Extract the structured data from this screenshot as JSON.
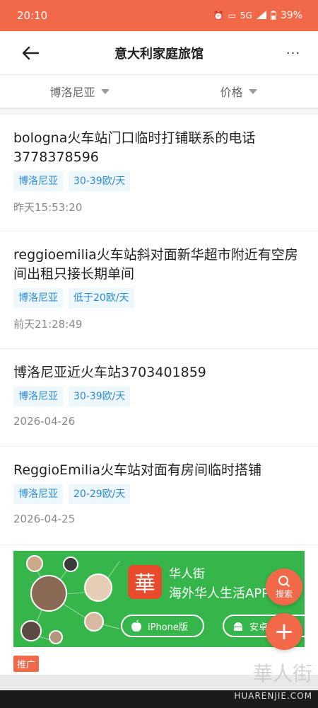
{
  "status_bar": {
    "time": "20:10",
    "network": "5G",
    "battery": "39%"
  },
  "nav": {
    "title": "意大利家庭旅馆",
    "more": "···"
  },
  "filters": [
    {
      "label": "博洛尼亚"
    },
    {
      "label": "价格"
    }
  ],
  "listings": [
    {
      "title": "bologna火车站门口临时打铺联系的电话3778378596",
      "tags": [
        "博洛尼亚",
        "30-39欧/天"
      ],
      "time": "昨天15:53:20"
    },
    {
      "title": "reggioemilia火车站斜对面新华超市附近有空房间出租只接长期单间",
      "tags": [
        "博洛尼亚",
        "低于20欧/天"
      ],
      "time": "前天21:28:49"
    },
    {
      "title": "博洛尼亚近火车站3703401859",
      "tags": [
        "博洛尼亚",
        "30-39欧/天"
      ],
      "time": "2026-04-26"
    },
    {
      "title": "ReggioEmilia火车站对面有房间临时搭铺",
      "tags": [
        "博洛尼亚",
        "20-29欧/天"
      ],
      "time": "2026-04-25"
    }
  ],
  "ad": {
    "logo_char": "華",
    "app_name": "华人街",
    "slogan": "海外华人生活APP",
    "iphone_label": "iPhone版",
    "android_label": "安卓版",
    "badge": "推广"
  },
  "fab": {
    "search_label": "搜索",
    "add_label": "+"
  },
  "watermark": {
    "cn": "華人街",
    "en": "HUARENJIE.COM"
  },
  "colors": {
    "accent": "#f2694a",
    "tag_text": "#2b8bd0",
    "tag_bg": "#eef7fc",
    "ad_green": "#36b54a"
  }
}
